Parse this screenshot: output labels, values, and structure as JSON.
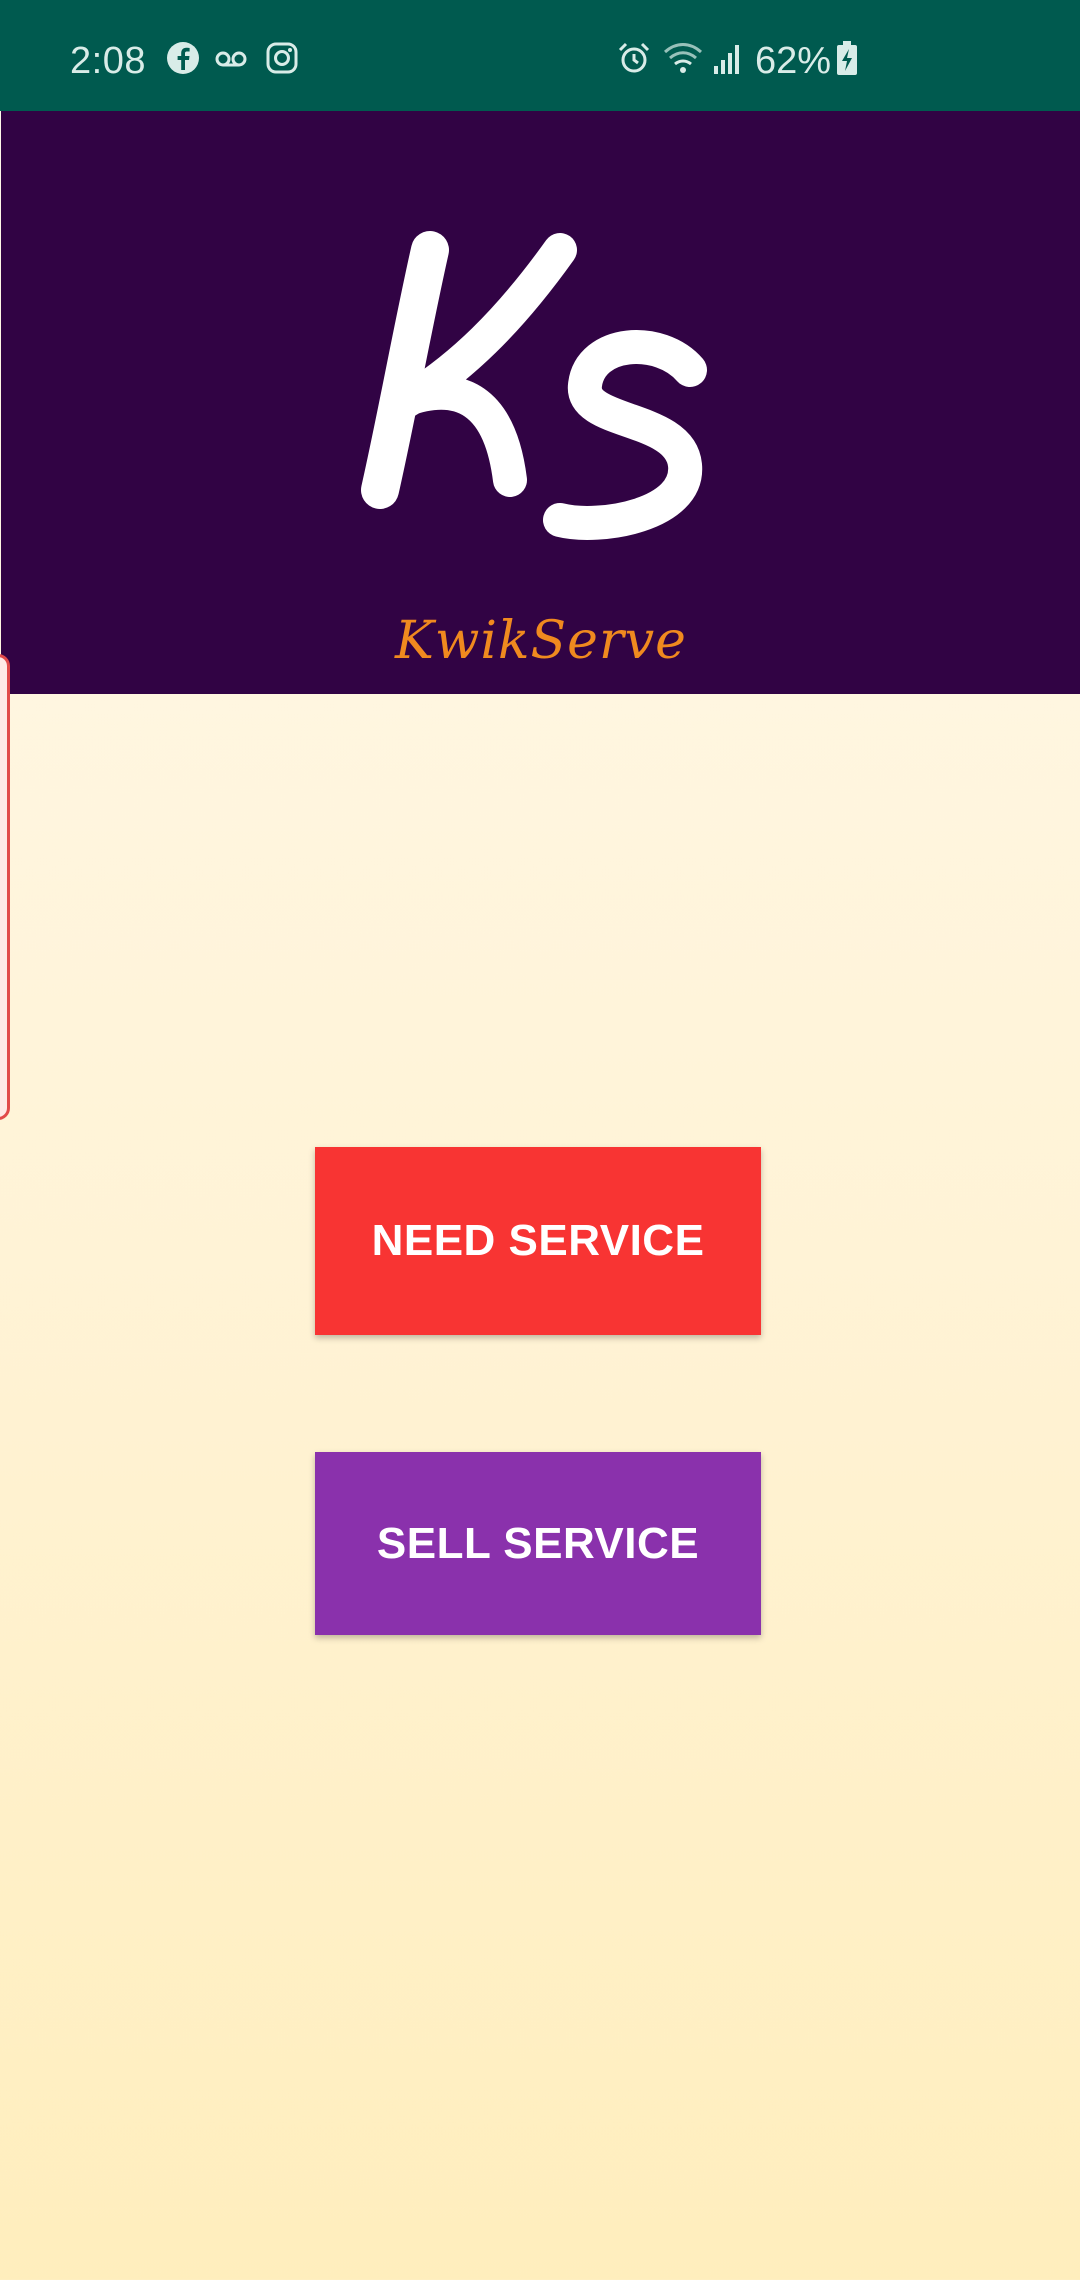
{
  "status_bar": {
    "time": "2:08",
    "battery_percent": "62%",
    "icons": [
      "facebook-icon",
      "voicemail-icon",
      "instagram-icon",
      "alarm-icon",
      "wifi-icon",
      "signal-icon",
      "battery-charging-icon"
    ],
    "background_color": "#005a4f"
  },
  "header": {
    "logo_text": "Ks",
    "app_name": "KwikServe",
    "background_color": "#310344",
    "app_name_color": "#f08a1f"
  },
  "buttons": {
    "need_service_label": "NEED SERVICE",
    "sell_service_label": "SELL SERVICE",
    "need_service_color": "#f83433",
    "sell_service_color": "#8a31ac"
  }
}
